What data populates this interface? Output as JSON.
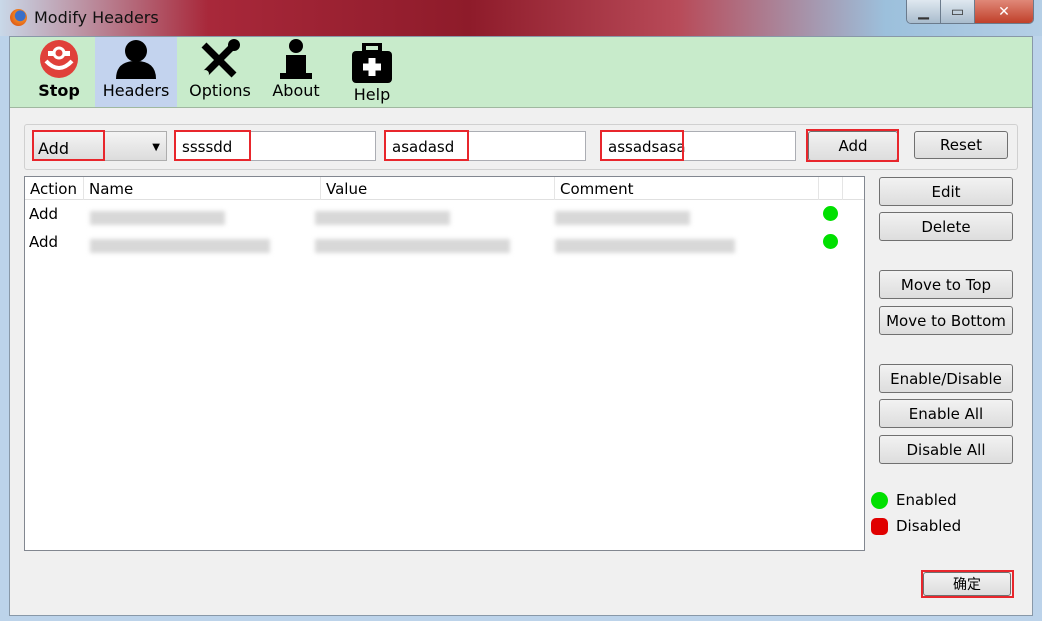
{
  "window": {
    "title": "Modify Headers",
    "controls": [
      "minimize",
      "maximize",
      "close"
    ]
  },
  "toolbar": {
    "items": [
      {
        "label": "Stop",
        "icon": "stop-icon"
      },
      {
        "label": "Headers",
        "icon": "user-icon",
        "selected": true
      },
      {
        "label": "Options",
        "icon": "tools-icon"
      },
      {
        "label": "About",
        "icon": "info-icon"
      },
      {
        "label": "Help",
        "icon": "first-aid-icon"
      }
    ]
  },
  "form": {
    "action": "Add",
    "name": "ssssdd",
    "value": "asadasd",
    "comment": "assadsasa",
    "add_label": "Add",
    "reset_label": "Reset"
  },
  "table": {
    "columns": [
      "Action",
      "Name",
      "Value",
      "Comment"
    ],
    "rows": [
      {
        "action": "Add",
        "enabled": true
      },
      {
        "action": "Add",
        "enabled": true
      }
    ]
  },
  "side_buttons": {
    "edit": "Edit",
    "delete": "Delete",
    "move_top": "Move to Top",
    "move_bottom": "Move to Bottom",
    "enable_disable": "Enable/Disable",
    "enable_all": "Enable All",
    "disable_all": "Disable All"
  },
  "legend": {
    "enabled": "Enabled",
    "disabled": "Disabled",
    "enabled_color": "#00e000",
    "disabled_color": "#e00000"
  },
  "ok_label": "确定"
}
